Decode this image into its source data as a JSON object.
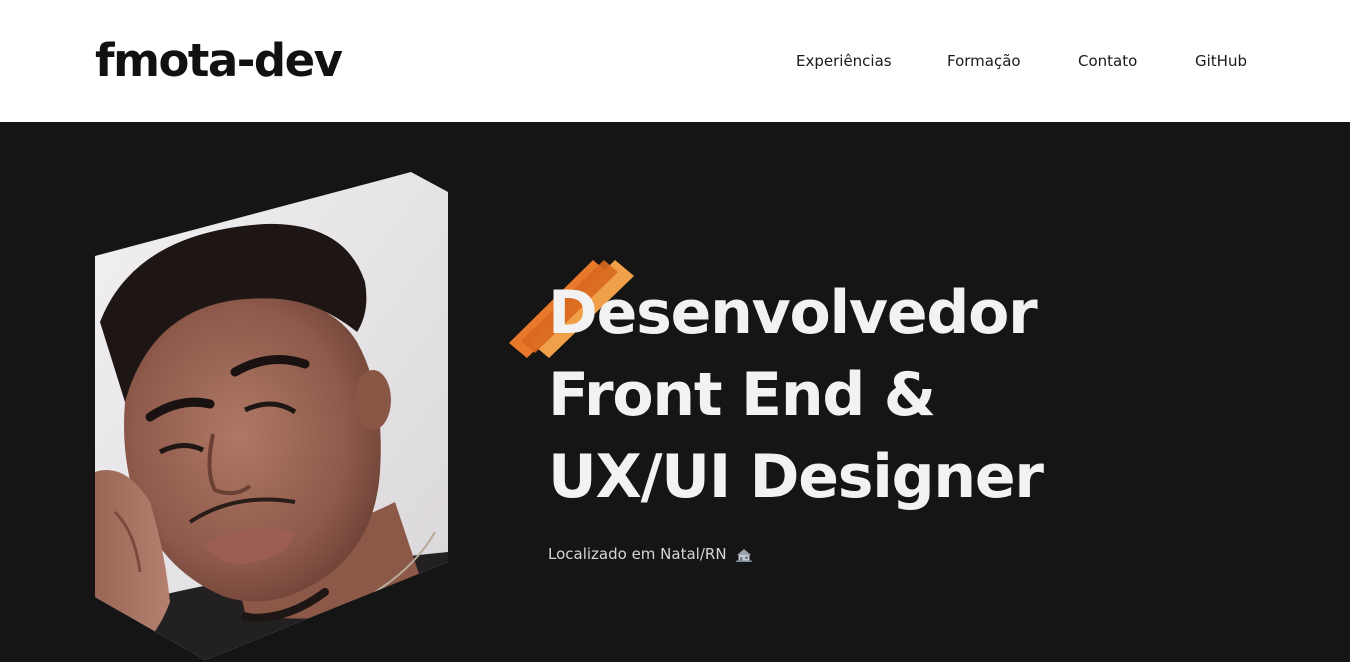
{
  "header": {
    "logo": "fmota-dev",
    "nav": [
      {
        "label": "Experiências"
      },
      {
        "label": "Formação"
      },
      {
        "label": "Contato"
      },
      {
        "label": "GitHub"
      }
    ]
  },
  "hero": {
    "headline_lines": [
      "Desenvolvedor",
      "Front End &",
      "UX/UI Designer"
    ],
    "location": "Localizado em Natal/RN",
    "location_icon": "house-icon",
    "photo_icon": "profile-photo",
    "accent_color": "#e8782a",
    "background_color": "#151515"
  }
}
